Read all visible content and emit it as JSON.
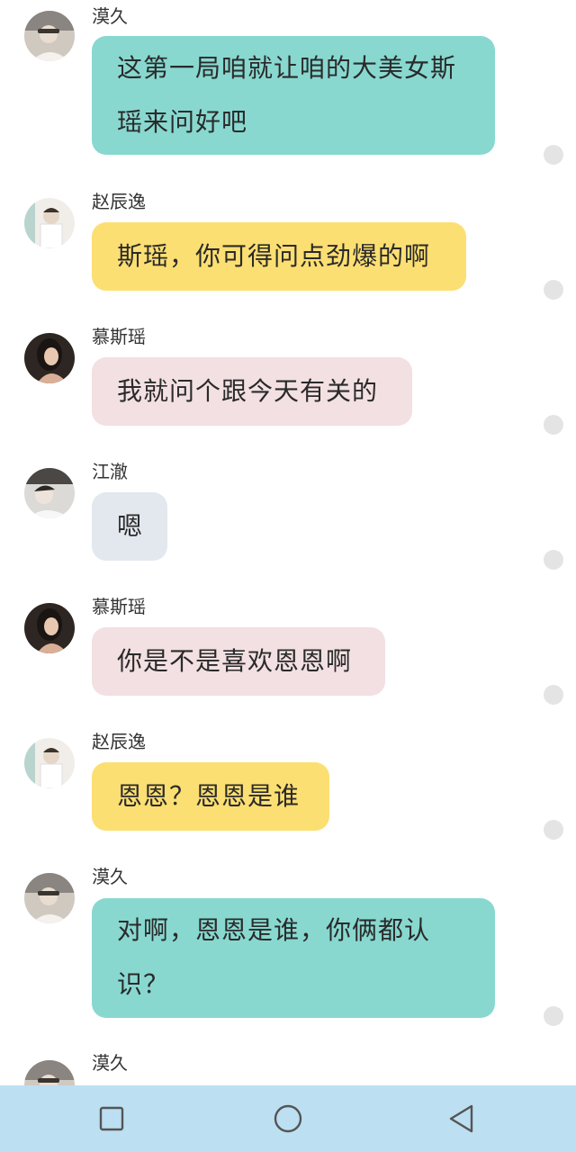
{
  "colors": {
    "teal_bubble": "#88d8d0",
    "yellow_bubble": "#fcdf72",
    "pink_bubble": "#f3e0e2",
    "gray_bubble": "#e3e8ef",
    "navbar_bg": "#bcdff2",
    "status_dot": "#e4e4e4"
  },
  "messages": [
    {
      "sender": "漠久",
      "text": "这第一局咱就让咱的大美女斯瑶来问好吧",
      "line1": "这第一局咱就让咱的大美女斯",
      "line2": "瑶来问好吧",
      "bubble": "teal",
      "avatar": "avatar-photo-icon"
    },
    {
      "sender": "赵辰逸",
      "text": "斯瑶，你可得问点劲爆的啊",
      "bubble": "yellow",
      "avatar": "avatar-photo-icon"
    },
    {
      "sender": "慕斯瑶",
      "text": "我就问个跟今天有关的",
      "bubble": "pink",
      "avatar": "avatar-photo-icon"
    },
    {
      "sender": "江澈",
      "text": "嗯",
      "bubble": "gray",
      "avatar": "avatar-photo-icon"
    },
    {
      "sender": "慕斯瑶",
      "text": "你是不是喜欢恩恩啊",
      "bubble": "pink",
      "avatar": "avatar-photo-icon"
    },
    {
      "sender": "赵辰逸",
      "text": "恩恩？恩恩是谁",
      "bubble": "yellow",
      "avatar": "avatar-photo-icon"
    },
    {
      "sender": "漠久",
      "text": "对啊，恩恩是谁，你俩都认识？",
      "line1": "对啊，恩恩是谁，你俩都认",
      "line2": "识？",
      "bubble": "teal",
      "avatar": "avatar-photo-icon"
    },
    {
      "sender": "漠久",
      "text": "",
      "bubble": "none",
      "avatar": "avatar-photo-icon"
    }
  ],
  "navbar": {
    "recent_icon": "square-recents-icon",
    "home_icon": "circle-home-icon",
    "back_icon": "triangle-back-icon"
  }
}
